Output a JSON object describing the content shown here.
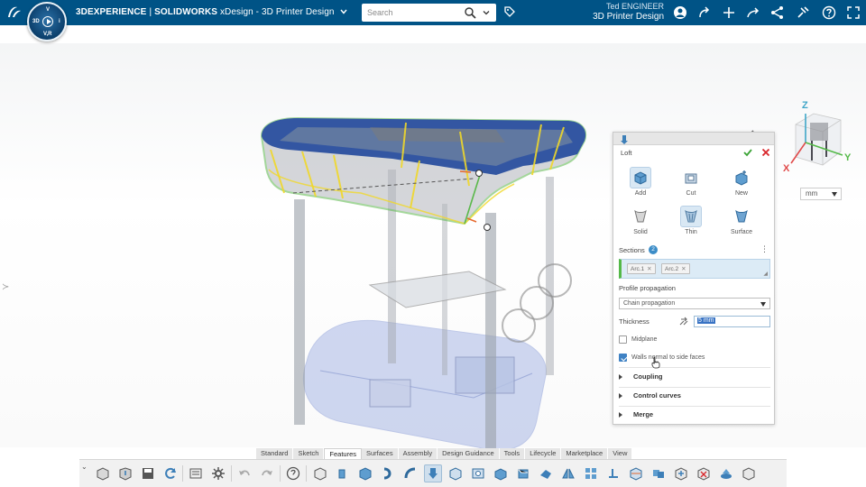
{
  "header": {
    "brand": "3DEXPERIENCE",
    "separator": "|",
    "product": "SOLIDWORKS",
    "app_name": "xDesign - 3D Printer Design",
    "search_placeholder": "Search",
    "user_name": "Ted ENGINEER",
    "user_app": "3D Printer Design",
    "compass_quadrants": [
      "3D",
      "V",
      "V,R",
      "i"
    ],
    "icons": [
      "avatar-icon",
      "share-icon",
      "add-icon",
      "forward-icon",
      "network-icon",
      "tools-icon",
      "help-icon",
      "fullscreen-icon"
    ]
  },
  "viewport": {
    "unit": "mm",
    "axis_labels": {
      "x": "X",
      "y": "Y",
      "z": "Z"
    },
    "colors": {
      "frame": "#2a4f9f",
      "selection": "#e5d83a",
      "edge": "#5ab84a"
    }
  },
  "panel": {
    "title": "Loft",
    "features": [
      {
        "label": "Add",
        "selected": true
      },
      {
        "label": "Cut",
        "selected": false
      },
      {
        "label": "New",
        "selected": false
      },
      {
        "label": "Solid",
        "selected": false
      },
      {
        "label": "Thin",
        "selected": true
      },
      {
        "label": "Surface",
        "selected": false
      }
    ],
    "sections_label": "Sections",
    "sections_count": "2",
    "sections": [
      "Arc.1",
      "Arc.2"
    ],
    "profile_propagation_label": "Profile propagation",
    "profile_propagation_value": "Chain propagation",
    "thickness_label": "Thickness",
    "thickness_value": "5 mm",
    "midplane_label": "Midplane",
    "midplane_checked": false,
    "walls_label": "Walls normal to side faces",
    "walls_checked": true,
    "collapsibles": [
      "Coupling",
      "Control curves",
      "Merge"
    ]
  },
  "tabs": [
    "Standard",
    "Sketch",
    "Features",
    "Surfaces",
    "Assembly",
    "Design Guidance",
    "Tools",
    "Lifecycle",
    "Marketplace",
    "View"
  ],
  "active_tab": "Features"
}
